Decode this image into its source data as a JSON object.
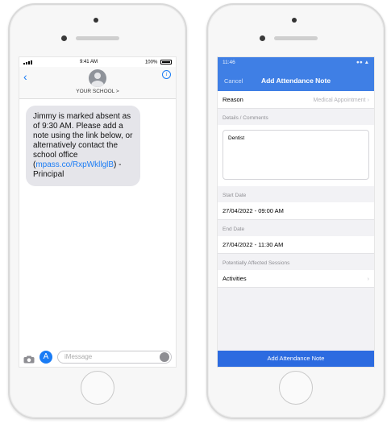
{
  "messages": {
    "status": {
      "time": "9:41 AM",
      "battery": "100%"
    },
    "header": {
      "contact": "YOUR SCHOOL >"
    },
    "message": {
      "text_before_link": "Jimmy is marked absent as of 9:30 AM. Please add a note using the link below, or alternatively contact the school office (",
      "link": "mpass.co/RxpWkllglB",
      "text_after_link": ") - Principal"
    },
    "input": {
      "placeholder": "iMessage"
    }
  },
  "attendance": {
    "status": {
      "time": "11:46"
    },
    "nav": {
      "cancel": "Cancel",
      "title": "Add Attendance Note"
    },
    "reason": {
      "label": "Reason",
      "value": "Medical Appointment"
    },
    "details": {
      "section": "Details / Comments",
      "text": "Dentist"
    },
    "start_date": {
      "section": "Start Date",
      "value": "27/04/2022 - 09:00 AM"
    },
    "end_date": {
      "section": "End Date",
      "value": "27/04/2022 - 11:30 AM"
    },
    "sessions": {
      "section": "Potentially Affected Sessions",
      "item": "Activities"
    },
    "submit_label": "Add Attendance Note"
  },
  "colors": {
    "ios_blue": "#1a7cf5",
    "app_blue": "#3f7fe5",
    "button_blue": "#2c6be0"
  }
}
